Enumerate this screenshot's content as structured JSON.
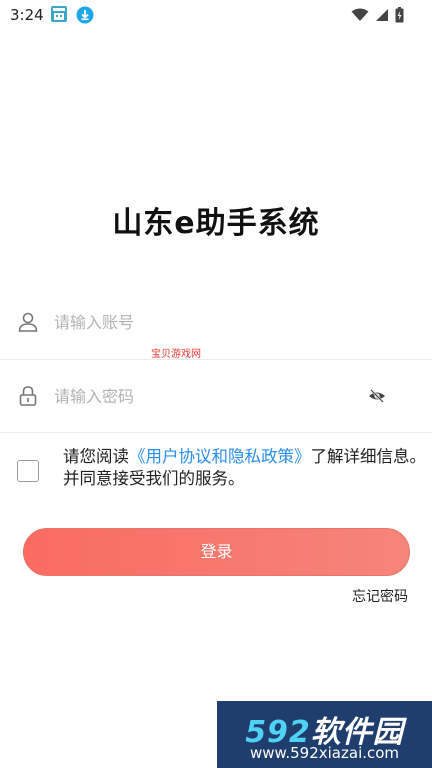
{
  "status_bar": {
    "time": "3:24"
  },
  "title": "山东e助手系统",
  "account": {
    "placeholder": "请输入账号",
    "value": ""
  },
  "watermark_small": "宝贝游戏网",
  "password": {
    "placeholder": "请输入密码",
    "value": ""
  },
  "agreement": {
    "checked": false,
    "prefix": "请您阅读",
    "link": "《用户协议和隐私政策》",
    "suffix": "了解详细信息。并同意接受我们的服务。"
  },
  "login_label": "登录",
  "forgot_label": "忘记密码",
  "site_badge": {
    "num": "592",
    "name": "软件园",
    "url": "www.592xiazai.com"
  },
  "colors": {
    "accent": "#f96b62",
    "link": "#2a8ef0"
  }
}
